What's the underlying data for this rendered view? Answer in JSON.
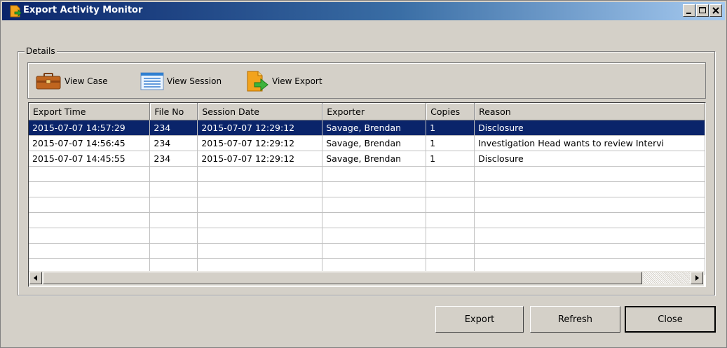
{
  "window": {
    "title": "Export Activity Monitor"
  },
  "details": {
    "group_label": "Details",
    "toolbar": {
      "view_case": "View Case",
      "view_session": "View Session",
      "view_export": "View Export"
    }
  },
  "grid": {
    "columns": [
      "Export Time",
      "File No",
      "Session Date",
      "Exporter",
      "Copies",
      "Reason"
    ],
    "rows": [
      [
        "2015-07-07 14:57:29",
        "234",
        "2015-07-07 12:29:12",
        "Savage, Brendan",
        "1",
        "Disclosure"
      ],
      [
        "2015-07-07 14:56:45",
        "234",
        "2015-07-07 12:29:12",
        "Savage, Brendan",
        "1",
        "Investigation Head wants to review Intervi"
      ],
      [
        "2015-07-07 14:45:55",
        "234",
        "2015-07-07 12:29:12",
        "Savage, Brendan",
        "1",
        "Disclosure"
      ]
    ],
    "selected_row": 0
  },
  "buttons": {
    "export": "Export",
    "refresh": "Refresh",
    "close": "Close"
  },
  "colors": {
    "title_bar": "#0a246a",
    "selection": "#0a246a",
    "face": "#d4d0c8"
  }
}
